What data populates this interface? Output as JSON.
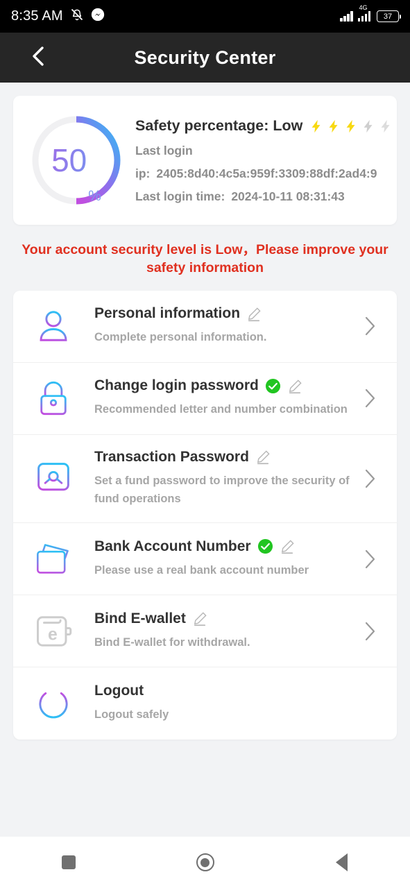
{
  "status_bar": {
    "time": "8:35 AM",
    "icons": [
      "mute-icon",
      "messenger-icon"
    ],
    "network_type": "4G",
    "battery_level": "37"
  },
  "header": {
    "title": "Security Center",
    "back_icon": "chevron-left-icon"
  },
  "safety_card": {
    "percentage": "50",
    "percent_sign": "%",
    "title": "Safety percentage: Low",
    "bolts_total": 5,
    "bolts_filled": 3,
    "last_login_label": "Last login",
    "ip_label": "ip:",
    "ip_value": "2405:8d40:4c5a:959f:3309:88df:2ad4:9",
    "last_login_time_label": "Last login time:",
    "last_login_time_value": "2024-10-11 08:31:43"
  },
  "warning": {
    "text": "Your account security level is Low，Please improve your safety information",
    "color": "#e03020"
  },
  "colors": {
    "gradient_start": "#2dc0f5",
    "gradient_end": "#c04fe0",
    "bolt_active": "#f8d911",
    "bolt_inactive": "#cfcfcf",
    "check_green": "#21c521",
    "header_bg": "#262626",
    "page_bg": "#f2f3f5"
  },
  "list": {
    "items": [
      {
        "icon": "person-icon",
        "title": "Personal information",
        "desc": "Complete personal information.",
        "verified": false,
        "has_pencil": true,
        "has_chevron": true,
        "icon_muted": false
      },
      {
        "icon": "lock-icon",
        "title": "Change login password",
        "desc": "Recommended letter and number combination",
        "verified": true,
        "has_pencil": true,
        "has_chevron": true,
        "icon_muted": false
      },
      {
        "icon": "safe-icon",
        "title": "Transaction Password",
        "desc": "Set a fund password to improve the security of fund operations",
        "verified": false,
        "has_pencil": true,
        "has_chevron": true,
        "icon_muted": false
      },
      {
        "icon": "bank-card-icon",
        "title": "Bank Account Number",
        "desc": "Please use a real bank account number",
        "verified": true,
        "has_pencil": true,
        "has_chevron": true,
        "icon_muted": false
      },
      {
        "icon": "wallet-icon",
        "title": "Bind E-wallet",
        "desc": "Bind E-wallet for withdrawal.",
        "verified": false,
        "has_pencil": true,
        "has_chevron": true,
        "icon_muted": true
      },
      {
        "icon": "power-icon",
        "title": "Logout",
        "desc": "Logout safely",
        "verified": false,
        "has_pencil": false,
        "has_chevron": false,
        "icon_muted": false
      }
    ]
  },
  "nav_bar": {
    "recents": "square-icon",
    "home": "circle-icon",
    "back": "triangle-back-icon"
  }
}
